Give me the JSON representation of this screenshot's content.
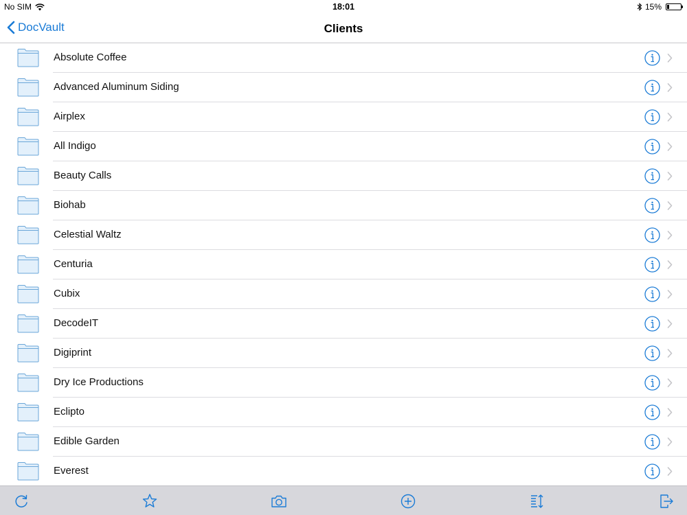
{
  "status": {
    "carrier": "No SIM",
    "time": "18:01",
    "battery_percent": "15%",
    "battery_level": 0.15,
    "icons": [
      "wifi-icon",
      "bluetooth-icon",
      "battery-icon"
    ]
  },
  "nav": {
    "back_label": "DocVault",
    "title": "Clients"
  },
  "colors": {
    "accent": "#1a7bd6",
    "folder_fill": "#e3f0fb",
    "folder_stroke": "#6aa6d8",
    "toolbar_bg": "#d7d7dc"
  },
  "clients": [
    {
      "name": "Absolute Coffee"
    },
    {
      "name": "Advanced Aluminum Siding"
    },
    {
      "name": "Airplex"
    },
    {
      "name": "All Indigo"
    },
    {
      "name": "Beauty Calls"
    },
    {
      "name": "Biohab"
    },
    {
      "name": "Celestial Waltz"
    },
    {
      "name": "Centuria"
    },
    {
      "name": "Cubix"
    },
    {
      "name": "DecodeIT"
    },
    {
      "name": "Digiprint"
    },
    {
      "name": "Dry Ice Productions"
    },
    {
      "name": "Eclipto"
    },
    {
      "name": "Edible Garden"
    },
    {
      "name": "Everest"
    }
  ],
  "toolbar": {
    "items": [
      "refresh-icon",
      "star-icon",
      "camera-icon",
      "add-icon",
      "sort-icon",
      "export-icon"
    ]
  }
}
